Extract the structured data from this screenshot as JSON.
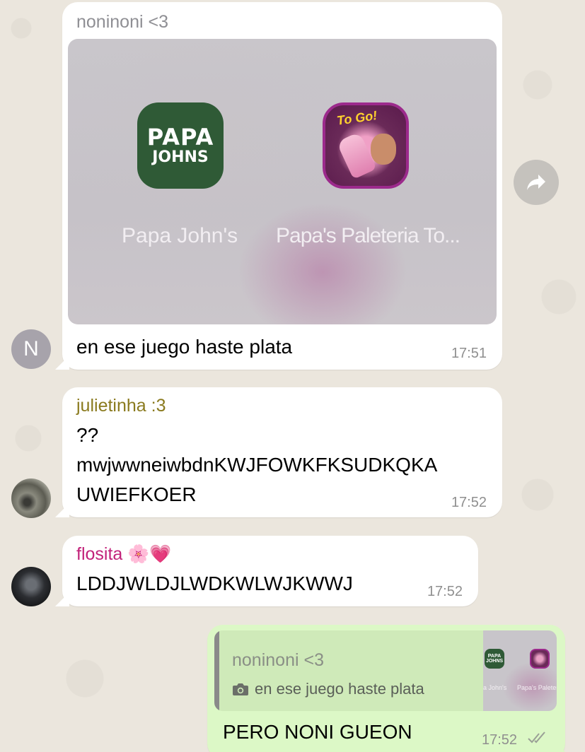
{
  "messages": [
    {
      "sender": "noninoni <3",
      "media": {
        "apps": [
          {
            "icon": "papa-johns-icon",
            "icon_line1": "PAPA",
            "icon_line2": "JOHNS",
            "label": "Papa John's"
          },
          {
            "icon": "papas-paleteria-icon",
            "icon_badge": "To Go!",
            "label": "Papa's Paleteria To..."
          }
        ]
      },
      "text": "en ese juego haste plata",
      "time": "17:51",
      "avatar_letter": "N"
    },
    {
      "sender": "julietinha :3",
      "lines": [
        "??",
        "mwjwwneiwbdnKWJFOWKFKSUDKQKA",
        "UWIEFKOER"
      ],
      "time": "17:52"
    },
    {
      "sender": "flosita 🌸💗",
      "text": "LDDJWLDJLWDKWLWJKWWJ",
      "time": "17:52"
    },
    {
      "outgoing": true,
      "reply_to": {
        "sender": "noninoni <3",
        "text": "en ese juego haste plata",
        "thumb_label1": "a John's",
        "thumb_label2": "Papa's Paleteria"
      },
      "text": "PERO NONI GUEON",
      "time": "17:52",
      "status": "read"
    }
  ],
  "colors": {
    "background": "#ebe6dd",
    "incoming_bubble": "#ffffff",
    "outgoing_bubble": "#dcf8c6",
    "sender1": "#8f8f94",
    "sender2": "#8a7a1e",
    "sender3": "#c2227a"
  }
}
